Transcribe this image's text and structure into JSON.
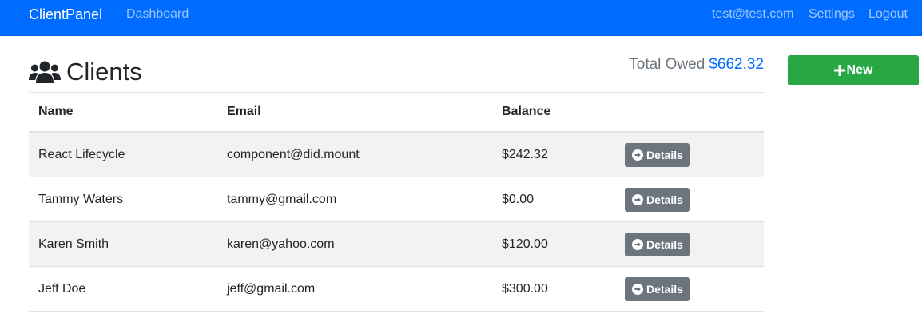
{
  "navbar": {
    "brand": "ClientPanel",
    "links": {
      "dashboard": "Dashboard",
      "email": "test@test.com",
      "settings": "Settings",
      "logout": "Logout"
    },
    "color": "#006cff"
  },
  "header": {
    "title": "Clients",
    "icon": "users-icon",
    "total_owed_label": "Total Owed",
    "total_owed_value": "$662.32",
    "new_button_label": "New",
    "new_button_icon": "plus-icon",
    "new_button_color": "#28a745"
  },
  "table": {
    "columns": [
      "Name",
      "Email",
      "Balance"
    ],
    "rows": [
      {
        "name": "React Lifecycle",
        "email": "component@did.mount",
        "balance": "$242.32",
        "action": "Details"
      },
      {
        "name": "Tammy Waters",
        "email": "tammy@gmail.com",
        "balance": "$0.00",
        "action": "Details"
      },
      {
        "name": "Karen Smith",
        "email": "karen@yahoo.com",
        "balance": "$120.00",
        "action": "Details"
      },
      {
        "name": "Jeff Doe",
        "email": "jeff@gmail.com",
        "balance": "$300.00",
        "action": "Details"
      }
    ],
    "action_icon": "arrow-circle-right-icon"
  }
}
